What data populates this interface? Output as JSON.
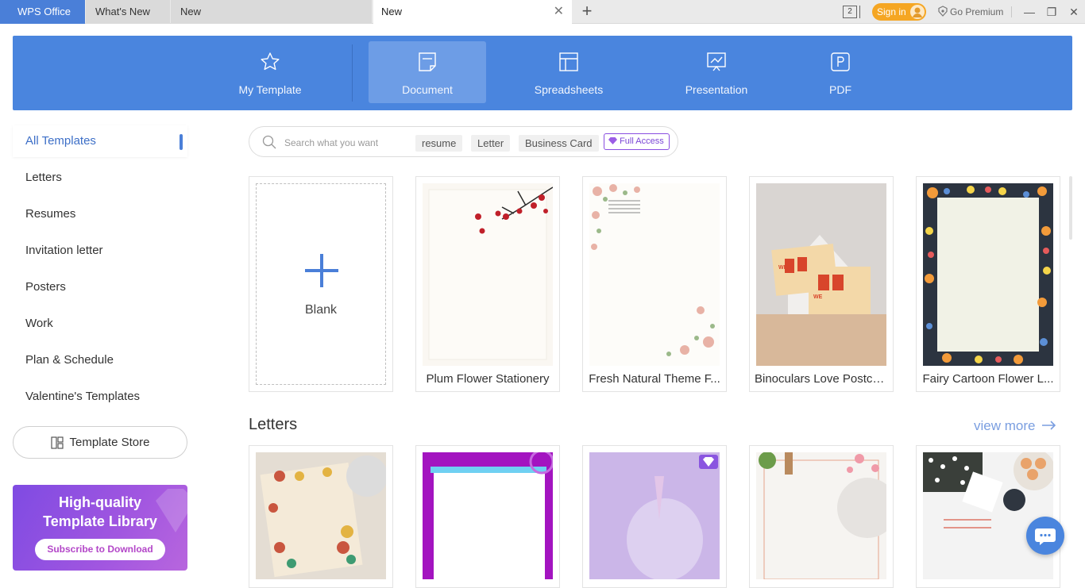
{
  "titlebar": {
    "tabs": [
      {
        "label": "WPS Office"
      },
      {
        "label": "What's New"
      },
      {
        "label": "New"
      },
      {
        "label": "New"
      }
    ],
    "window_count": "2",
    "signin_label": "Sign in",
    "go_premium_label": "Go Premium",
    "accent": "#4a7fd8",
    "signin_color": "#f5a623"
  },
  "categories": [
    {
      "label": "My Template",
      "icon": "star-icon"
    },
    {
      "label": "Document",
      "icon": "document-icon",
      "active": true
    },
    {
      "label": "Spreadsheets",
      "icon": "spreadsheet-icon"
    },
    {
      "label": "Presentation",
      "icon": "presentation-icon"
    },
    {
      "label": "PDF",
      "icon": "pdf-icon"
    }
  ],
  "sidebar": {
    "items": [
      {
        "label": "All Templates",
        "active": true
      },
      {
        "label": "Letters"
      },
      {
        "label": "Resumes"
      },
      {
        "label": "Invitation letter"
      },
      {
        "label": "Posters"
      },
      {
        "label": "Work"
      },
      {
        "label": "Plan & Schedule"
      },
      {
        "label": "Valentine's Templates"
      }
    ],
    "store_label": "Template Store",
    "promo": {
      "title_line1": "High-quality",
      "title_line2": "Template Library",
      "button_label": "Subscribe to Download"
    }
  },
  "search": {
    "placeholder": "Search what you want",
    "value": "",
    "tags": [
      "resume",
      "Letter",
      "Business Card"
    ],
    "full_access_label": "Full Access"
  },
  "templates": {
    "blank_label": "Blank",
    "cards": [
      {
        "title": "Plum Flower Stationery"
      },
      {
        "title": "Fresh Natural Theme F..."
      },
      {
        "title": "Binoculars Love Postca..."
      },
      {
        "title": "Fairy Cartoon Flower L..."
      }
    ]
  },
  "letters_section": {
    "title": "Letters",
    "view_more_label": "view more"
  }
}
